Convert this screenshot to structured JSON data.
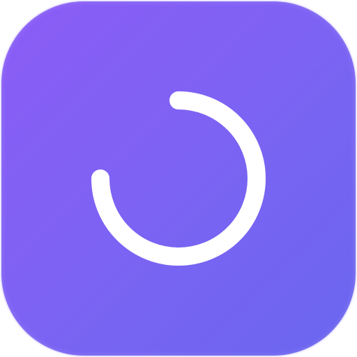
{
  "icon": {
    "name": "loading-spinner-app-icon",
    "gradient_start": "#8b5cf6",
    "gradient_end": "#6a66f0",
    "spinner_color": "#ffffff",
    "spinner_icon": "loading-arc-icon",
    "progress_fraction": 0.75
  }
}
